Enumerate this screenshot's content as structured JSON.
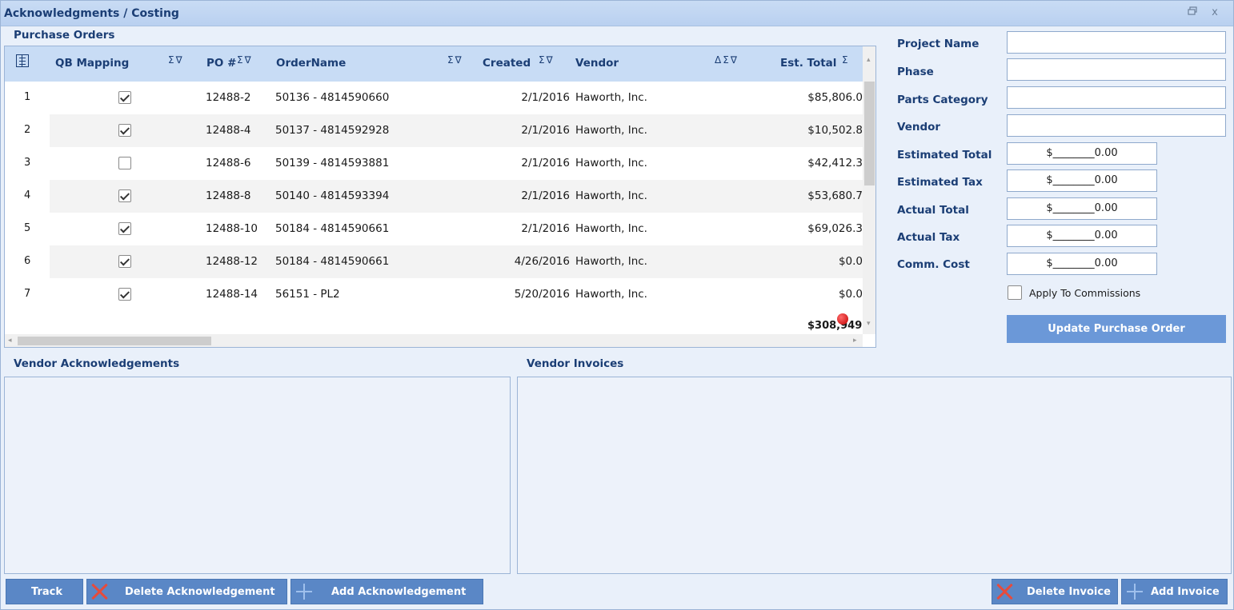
{
  "window": {
    "title": "Acknowledgments / Costing",
    "restore_icon": "restore-icon",
    "close_icon": "close-icon",
    "close_glyph": "x"
  },
  "purchase_orders": {
    "title": "Purchase Orders",
    "columns": {
      "qb_mapping": "QB Mapping",
      "po_number": "PO #",
      "order_name": "OrderName",
      "created": "Created",
      "vendor": "Vendor",
      "est_total": "Est. Total"
    },
    "header_icons": {
      "sum": "Σ",
      "filter": "∇",
      "sort_asc": "Δ"
    },
    "rows": [
      {
        "num": "1",
        "qb": true,
        "po": "12488-2",
        "order": "50136 - 4814590660",
        "created": "2/1/2016",
        "vendor": "Haworth, Inc.",
        "total": "$85,806.0"
      },
      {
        "num": "2",
        "qb": true,
        "po": "12488-4",
        "order": "50137 - 4814592928",
        "created": "2/1/2016",
        "vendor": "Haworth, Inc.",
        "total": "$10,502.8"
      },
      {
        "num": "3",
        "qb": false,
        "po": "12488-6",
        "order": "50139 - 4814593881",
        "created": "2/1/2016",
        "vendor": "Haworth, Inc.",
        "total": "$42,412.3"
      },
      {
        "num": "4",
        "qb": true,
        "po": "12488-8",
        "order": "50140 - 4814593394",
        "created": "2/1/2016",
        "vendor": "Haworth, Inc.",
        "total": "$53,680.7"
      },
      {
        "num": "5",
        "qb": true,
        "po": "12488-10",
        "order": "50184 - 4814590661",
        "created": "2/1/2016",
        "vendor": "Haworth, Inc.",
        "total": "$69,026.3"
      },
      {
        "num": "6",
        "qb": true,
        "po": "12488-12",
        "order": "50184 - 4814590661",
        "created": "4/26/2016",
        "vendor": "Haworth, Inc.",
        "total": "$0.0"
      },
      {
        "num": "7",
        "qb": true,
        "po": "12488-14",
        "order": "56151 - PL2",
        "created": "5/20/2016",
        "vendor": "Haworth, Inc.",
        "total": "$0.0"
      }
    ],
    "grand_total": "$308,949.1"
  },
  "form": {
    "project_name": {
      "label": "Project Name",
      "value": ""
    },
    "phase": {
      "label": "Phase",
      "value": ""
    },
    "parts_category": {
      "label": "Parts Category",
      "value": ""
    },
    "vendor": {
      "label": "Vendor",
      "value": ""
    },
    "estimated_total": {
      "label": "Estimated Total",
      "value": "$________0.00"
    },
    "estimated_tax": {
      "label": "Estimated Tax",
      "value": "$________0.00"
    },
    "actual_total": {
      "label": "Actual Total",
      "value": "$________0.00"
    },
    "actual_tax": {
      "label": "Actual Tax",
      "value": "$________0.00"
    },
    "comm_cost": {
      "label": "Comm. Cost",
      "value": "$________0.00"
    },
    "apply_to_commissions": {
      "label": "Apply To Commissions",
      "checked": false
    },
    "update_button": "Update Purchase Order"
  },
  "vendor_acknowledgements": {
    "title": "Vendor Acknowledgements"
  },
  "vendor_invoices": {
    "title": "Vendor Invoices"
  },
  "buttons": {
    "track": "Track",
    "delete_acknowledgement": "Delete Acknowledgement",
    "add_acknowledgement": "Add Acknowledgement",
    "delete_invoice": "Delete Invoice",
    "add_invoice": "Add Invoice"
  },
  "colors": {
    "title_text": "#1b3e75",
    "header_bg": "#c8dcf5",
    "button_bg": "#5a87c6",
    "update_button_bg": "#6b98d8",
    "delete_icon": "#e64b3c"
  }
}
